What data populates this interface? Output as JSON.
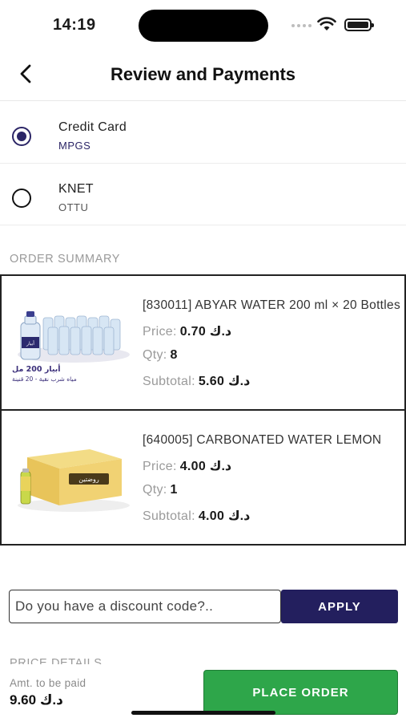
{
  "status_bar": {
    "time": "14:19"
  },
  "header": {
    "title": "Review and Payments"
  },
  "payment_methods": [
    {
      "name": "Credit Card",
      "provider": "MPGS",
      "selected": true
    },
    {
      "name": "KNET",
      "provider": "OTTU",
      "selected": false
    }
  ],
  "order_summary": {
    "label": "ORDER SUMMARY",
    "items": [
      {
        "title": "[830011] ABYAR WATER 200 ml × 20 Bottles",
        "price_label": "Price:",
        "price": "0.70 د.ك",
        "qty_label": "Qty:",
        "qty": "8",
        "subtotal_label": "Subtotal:",
        "subtotal": "5.60 د.ك",
        "image_text_1": "أبيار 200 مل",
        "image_text_2": "مياه شرب نقية - 20 قنينة",
        "image_brand": "أبيار",
        "icon": "water-bottles-pack"
      },
      {
        "title": "[640005] CARBONATED  WATER LEMON",
        "price_label": "Price:",
        "price": "4.00 د.ك",
        "qty_label": "Qty:",
        "qty": "1",
        "subtotal_label": "Subtotal:",
        "subtotal": "4.00 د.ك",
        "image_brand": "روضتين",
        "icon": "carbonated-water-box"
      }
    ]
  },
  "discount": {
    "placeholder": "Do you have a discount code?..",
    "apply_label": "APPLY"
  },
  "price_details": {
    "label": "PRICE DETAILS"
  },
  "footer": {
    "amount_label": "Amt. to be paid",
    "amount_value": "9.60 د.ك",
    "place_order_label": "PLACE ORDER"
  },
  "colors": {
    "primary": "#231f5e",
    "success": "#2ea64a",
    "muted": "#9a9a9a"
  }
}
